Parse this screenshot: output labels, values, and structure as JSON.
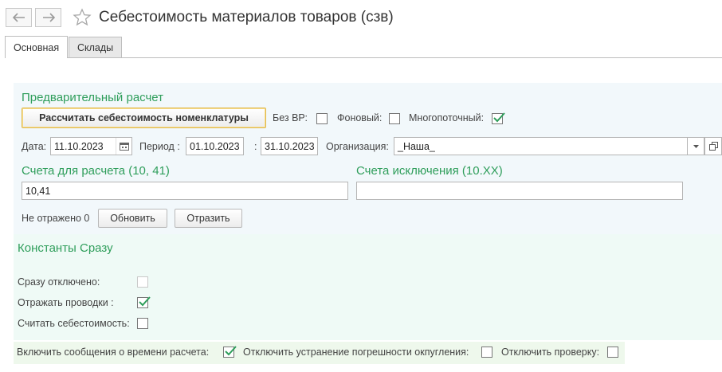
{
  "header": {
    "title": "Себестоимость материалов товаров (сзв)"
  },
  "tabs": [
    {
      "label": "Основная"
    },
    {
      "label": "Склады"
    }
  ],
  "prelim": {
    "title": "Предварительный расчет",
    "calc_button": "Рассчитать себестоимость номенклатуры",
    "no_vr_label": "Без ВР:",
    "background_label": "Фоновый:",
    "multithread_label": "Многопоточный:",
    "date_label": "Дата:",
    "date_value": "11.10.2023",
    "period_label": "Период :",
    "period_from": "01.10.2023",
    "period_sep": ":",
    "period_to": "31.10.2023",
    "org_label": "Организация:",
    "org_value": "_Наша_",
    "accounts_title": "Счета для расчета (10, 41)",
    "accounts_value": "10,41",
    "exclusions_title": "Счета исключения (10.ХХ)",
    "exclusions_value": "",
    "not_reflected": "Не отражено 0",
    "refresh_button": "Обновить",
    "reflect_button": "Отразить"
  },
  "constants": {
    "title": "Константы Сразу",
    "disabled_label": "Сразу отключено:",
    "postings_label": "Отражать проводки :",
    "cost_label": "Считать себестоимость:"
  },
  "bottom": {
    "messages_label": "Включить сообщения о времени расчета:",
    "rounding_label": "Отключить устранение погрешности окпугления:",
    "check_label": "Отключить проверку:"
  }
}
